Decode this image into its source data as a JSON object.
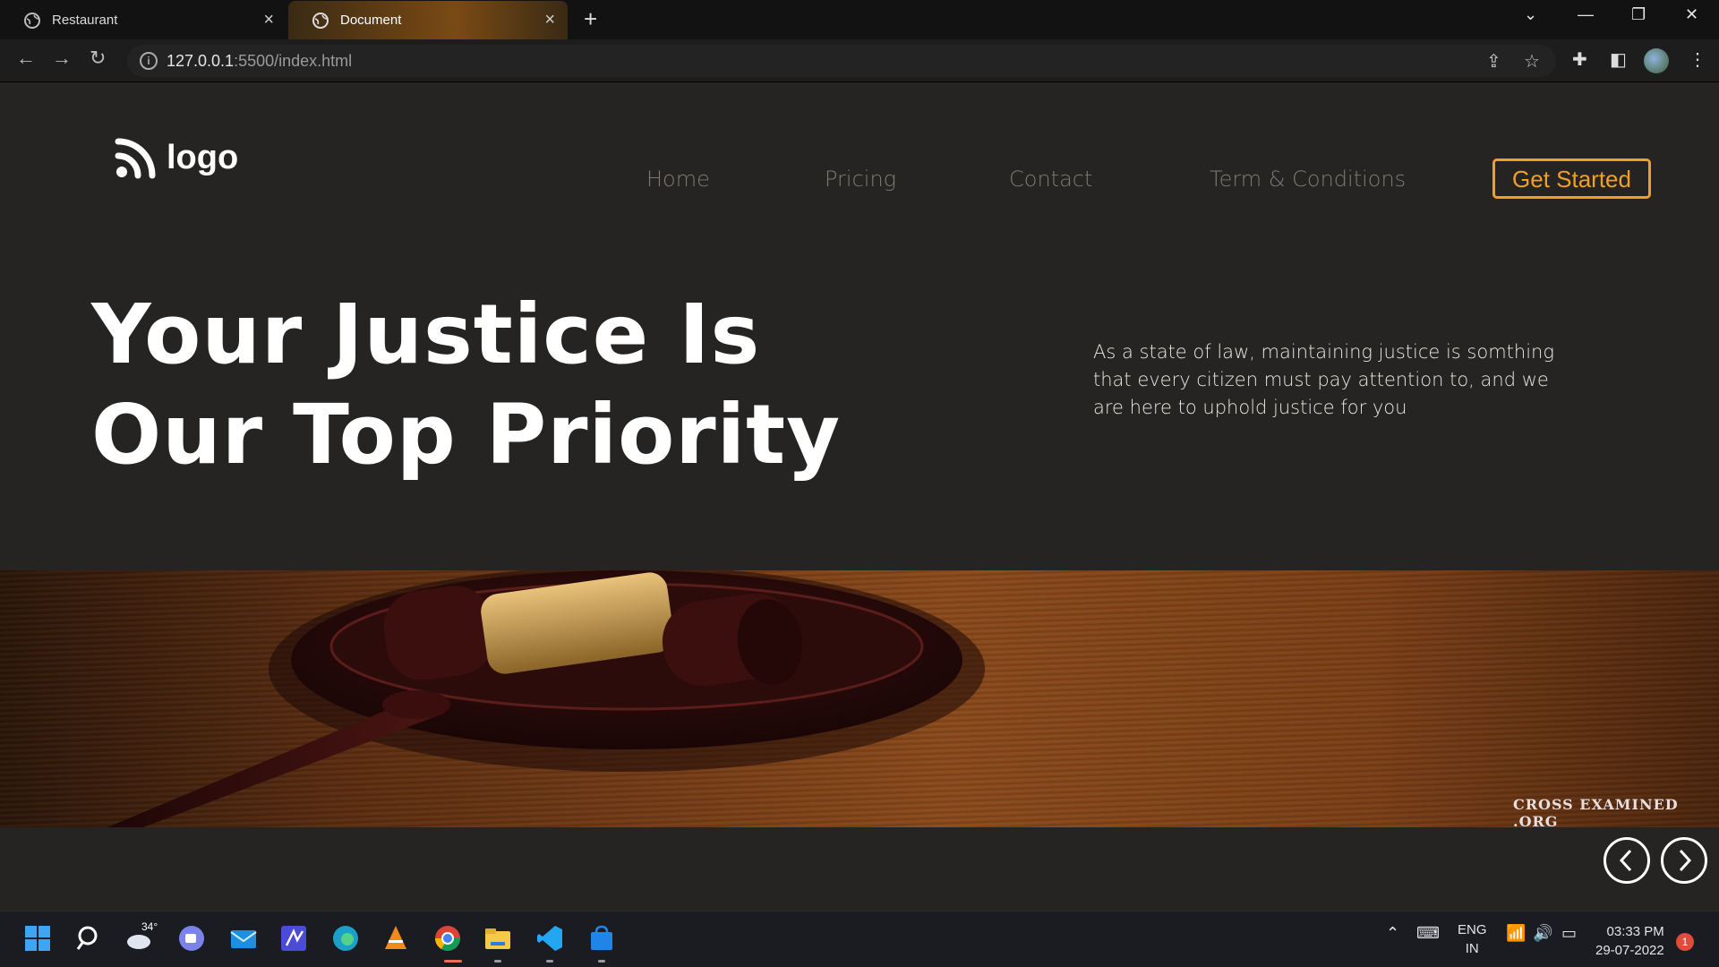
{
  "browser": {
    "tabs": [
      {
        "title": "Restaurant",
        "active": false
      },
      {
        "title": "Document",
        "active": true
      }
    ],
    "url_host": "127.0.0.1",
    "url_path": ":5500/index.html"
  },
  "site": {
    "logo_text": "logo",
    "nav": [
      "Home",
      "Pricing",
      "Contact",
      "Term & Conditions"
    ],
    "cta_label": "Get Started",
    "hero_title_line1": "Your Justice Is",
    "hero_title_line2": "Our Top Priority",
    "hero_description": "As a state of law, maintaining justice is somthing that every citizen must pay attention to, and we are here to uphold justice for you",
    "image_watermark": "CROSS EXAMINED .ORG",
    "accent_color": "#f0a022"
  },
  "taskbar": {
    "weather_temp": "34°",
    "lang_line1": "ENG",
    "lang_line2": "IN",
    "time": "03:33 PM",
    "date": "29-07-2022",
    "notifications": "1"
  }
}
